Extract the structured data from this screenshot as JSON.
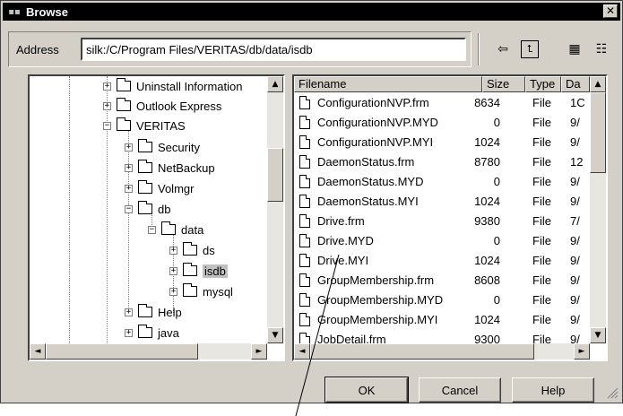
{
  "window": {
    "title": "Browse",
    "close_glyph": "✕"
  },
  "address": {
    "label": "Address",
    "value": "silk:/C/Program Files/VERITAS/db/data/isdb"
  },
  "toolbar": {
    "back_icon": "⇦",
    "up_icon": "⮤",
    "list_icon": "▦",
    "details_icon": "☷"
  },
  "tree": {
    "items": [
      {
        "label": "Uninstall Information",
        "expander": "+"
      },
      {
        "label": "Outlook Express",
        "expander": "+"
      },
      {
        "label": "VERITAS",
        "expander": "−"
      },
      {
        "label": "Security",
        "expander": "+"
      },
      {
        "label": "NetBackup",
        "expander": "+"
      },
      {
        "label": "Volmgr",
        "expander": "+"
      },
      {
        "label": "db",
        "expander": "−"
      },
      {
        "label": "data",
        "expander": "−"
      },
      {
        "label": "ds",
        "expander": "+"
      },
      {
        "label": "isdb",
        "expander": "+"
      },
      {
        "label": "mysql",
        "expander": "+"
      },
      {
        "label": "Help",
        "expander": "+"
      },
      {
        "label": "java",
        "expander": "+"
      }
    ],
    "selected": "isdb"
  },
  "files": {
    "columns": [
      "Filename",
      "Size",
      "Type",
      "Da"
    ],
    "rows": [
      {
        "name": "ConfigurationNVP.frm",
        "size": "8634",
        "type": "File",
        "date": "1C"
      },
      {
        "name": "ConfigurationNVP.MYD",
        "size": "0",
        "type": "File",
        "date": "9/"
      },
      {
        "name": "ConfigurationNVP.MYI",
        "size": "1024",
        "type": "File",
        "date": "9/"
      },
      {
        "name": "DaemonStatus.frm",
        "size": "8780",
        "type": "File",
        "date": "12"
      },
      {
        "name": "DaemonStatus.MYD",
        "size": "0",
        "type": "File",
        "date": "9/"
      },
      {
        "name": "DaemonStatus.MYI",
        "size": "1024",
        "type": "File",
        "date": "9/"
      },
      {
        "name": "Drive.frm",
        "size": "9380",
        "type": "File",
        "date": "7/"
      },
      {
        "name": "Drive.MYD",
        "size": "0",
        "type": "File",
        "date": "9/"
      },
      {
        "name": "Drive.MYI",
        "size": "1024",
        "type": "File",
        "date": "9/"
      },
      {
        "name": "GroupMembership.frm",
        "size": "8608",
        "type": "File",
        "date": "9/"
      },
      {
        "name": "GroupMembership.MYD",
        "size": "0",
        "type": "File",
        "date": "9/"
      },
      {
        "name": "GroupMembership.MYI",
        "size": "1024",
        "type": "File",
        "date": "9/"
      },
      {
        "name": "JobDetail.frm",
        "size": "9300",
        "type": "File",
        "date": "9/"
      }
    ]
  },
  "buttons": {
    "ok": "OK",
    "cancel": "Cancel",
    "help": "Help"
  },
  "scroll": {
    "up": "▲",
    "down": "▼",
    "left": "◄",
    "right": "►"
  },
  "colors": {
    "face": "#d4d0c8",
    "title_bg": "#000000",
    "selection": "#c0c0c0"
  }
}
